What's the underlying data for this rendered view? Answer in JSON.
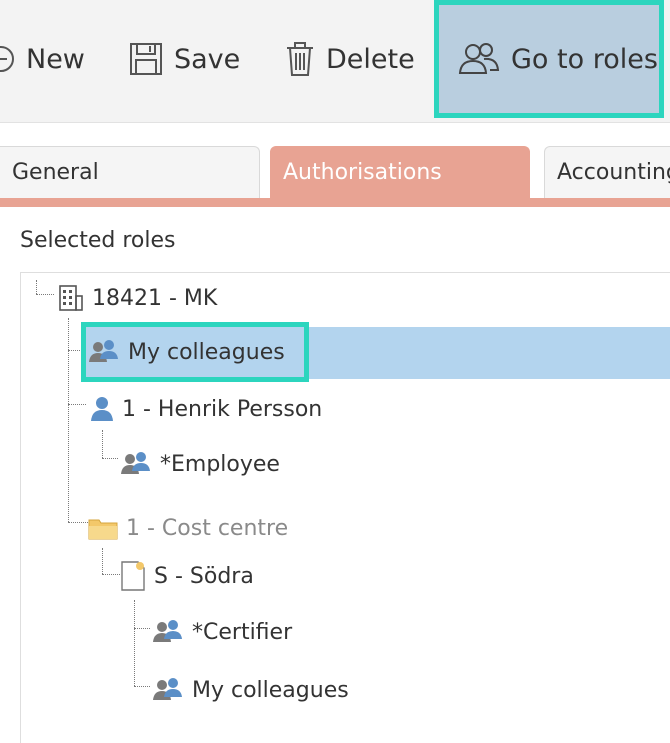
{
  "toolbar": {
    "new_label": "New",
    "save_label": "Save",
    "delete_label": "Delete",
    "goto_roles_label": "Go to roles"
  },
  "tabs": [
    {
      "label": "General",
      "active": false
    },
    {
      "label": "Authorisations",
      "active": true
    },
    {
      "label": "Accounting",
      "active": false
    }
  ],
  "section": {
    "title": "Selected roles"
  },
  "tree": {
    "root": {
      "label": "18421 - MK",
      "icon": "building-icon"
    },
    "my_colleagues": {
      "label": "My colleagues",
      "icon": "group-icon",
      "selected": true
    },
    "person": {
      "label": "1 - Henrik Persson",
      "icon": "person-icon"
    },
    "employee": {
      "label": "*Employee",
      "icon": "group-icon"
    },
    "cost_centre": {
      "label": "1 - Cost centre",
      "icon": "folder-icon"
    },
    "sodra": {
      "label": "S - Södra",
      "icon": "document-icon"
    },
    "certifier": {
      "label": "*Certifier",
      "icon": "group-icon"
    },
    "my_colleagues_2": {
      "label": "My colleagues",
      "icon": "group-icon"
    }
  },
  "colors": {
    "accent_tab": "#e8a393",
    "highlight": "#2cd5be",
    "selected_row": "#b3d4ee",
    "roles_button": "#b9cedf",
    "group_icon": "#5b8fc7"
  }
}
